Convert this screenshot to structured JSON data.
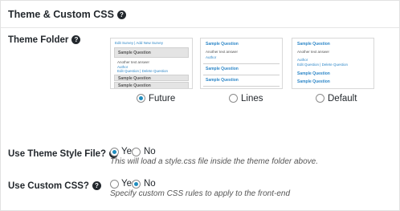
{
  "panel": {
    "title": "Theme & Custom CSS",
    "help_glyph": "?"
  },
  "theme_folder": {
    "label": "Theme Folder",
    "options": [
      {
        "name": "Future",
        "selected": true,
        "preview": {
          "top_link": "Edit Survey | Add New Survey",
          "question": "Sample Question",
          "answer": "Another text answer",
          "author": "Author",
          "links": "Edit Question | Delete Question",
          "question2": "Sample Question",
          "question3": "Sample Question"
        }
      },
      {
        "name": "Lines",
        "selected": false,
        "preview": {
          "question": "Sample Question",
          "answer": "Another text answer",
          "author": "Author",
          "question2": "Sample Question",
          "question3": "Sample Question"
        }
      },
      {
        "name": "Default",
        "selected": false,
        "preview": {
          "question": "Sample Question",
          "answer": "Another text answer",
          "author": "Author",
          "links": "Edit Question | Delete Question",
          "question2": "Sample Question",
          "question3": "Sample Question"
        }
      }
    ]
  },
  "theme_style": {
    "label": "Use Theme Style File?",
    "yes_label": "Yes",
    "no_label": "No",
    "selected": "Yes",
    "description": "This will load a style.css file inside the theme folder above."
  },
  "custom_css": {
    "label": "Use Custom CSS?",
    "yes_label": "Yes",
    "no_label": "No",
    "selected": "No",
    "description": "Specify custom CSS rules to apply to the front-end"
  },
  "colors": {
    "accent": "#1e8cbe",
    "link": "#2e87c8"
  },
  "icons": [
    "help-icon",
    "radio-button"
  ]
}
